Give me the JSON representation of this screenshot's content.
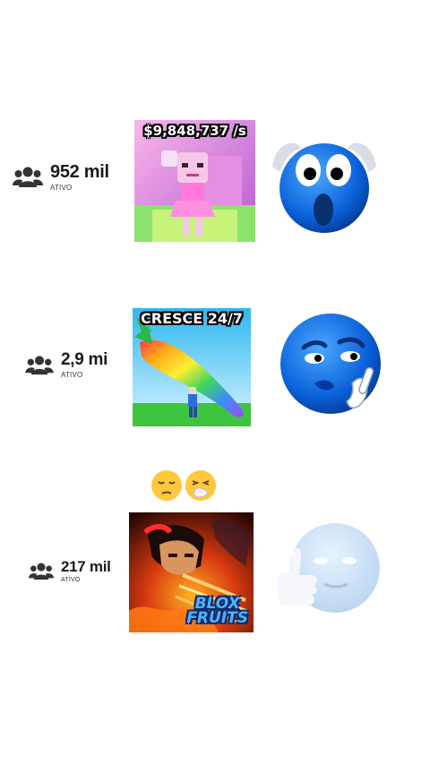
{
  "rows": [
    {
      "count": "952 mil",
      "status": "ATIVO",
      "thumbnail": {
        "caption": "$9,848,737 /s",
        "theme": "pink",
        "colors": [
          "#f7a8e0",
          "#c86bd6"
        ]
      },
      "reaction": {
        "icon": "shocked-blue-face-icon"
      }
    },
    {
      "count": "2,9 mi",
      "status": "ATIVO",
      "thumbnail": {
        "caption": "CRESCE 24/7",
        "theme": "sky",
        "colors": [
          "#6fd0ff",
          "#3dbb3d"
        ]
      },
      "reaction": {
        "icon": "smug-blue-face-icon"
      }
    },
    {
      "count": "217 mil",
      "status": "ATIVO",
      "thumbnail": {
        "caption_line1": "BLOX",
        "caption_line2": "FRUITS",
        "theme": "fire",
        "colors": [
          "#3a0a05",
          "#ff8a1a"
        ]
      },
      "reaction": {
        "icon": "fading-thumbs-up-face-icon"
      }
    }
  ],
  "separator_emojis": [
    "😔",
    "🤧"
  ],
  "colors": {
    "text": "#1a1a1a",
    "users_icon": "#333333"
  }
}
